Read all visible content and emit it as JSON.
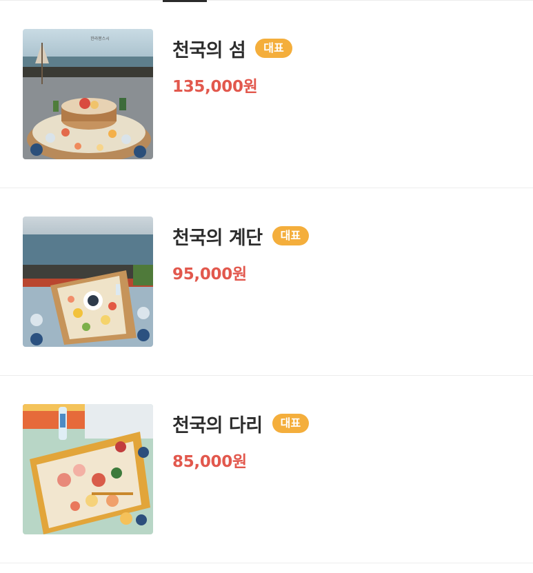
{
  "menu": {
    "items": [
      {
        "name": "천국의 섬",
        "badge": "대표",
        "price": "135,000원",
        "image_caption": "한라봉스시"
      },
      {
        "name": "천국의 계단",
        "badge": "대표",
        "price": "95,000원"
      },
      {
        "name": "천국의 다리",
        "badge": "대표",
        "price": "85,000원"
      }
    ]
  },
  "colors": {
    "badge": "#f4ae3c",
    "price": "#e2584d",
    "name": "#2d2d2d",
    "divider": "#ececec"
  }
}
